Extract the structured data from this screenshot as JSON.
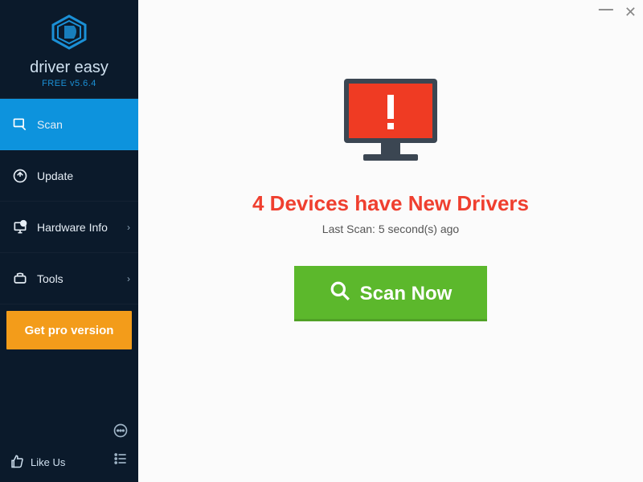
{
  "brand": {
    "name": "driver easy",
    "version_line": "FREE v5.6.4"
  },
  "sidebar": {
    "items": [
      {
        "label": "Scan",
        "active": true,
        "has_chevron": false
      },
      {
        "label": "Update",
        "active": false,
        "has_chevron": false
      },
      {
        "label": "Hardware Info",
        "active": false,
        "has_chevron": true
      },
      {
        "label": "Tools",
        "active": false,
        "has_chevron": true
      }
    ],
    "pro_button": "Get pro version",
    "like_us": "Like Us"
  },
  "main": {
    "headline": "4 Devices have New Drivers",
    "last_scan": "Last Scan: 5 second(s) ago",
    "scan_button": "Scan Now"
  },
  "colors": {
    "accent": "#0d93dd",
    "alert": "#ef3f2f",
    "green": "#5cb82c",
    "orange": "#f39c1a",
    "sidebar_bg": "#0b1a2b"
  }
}
